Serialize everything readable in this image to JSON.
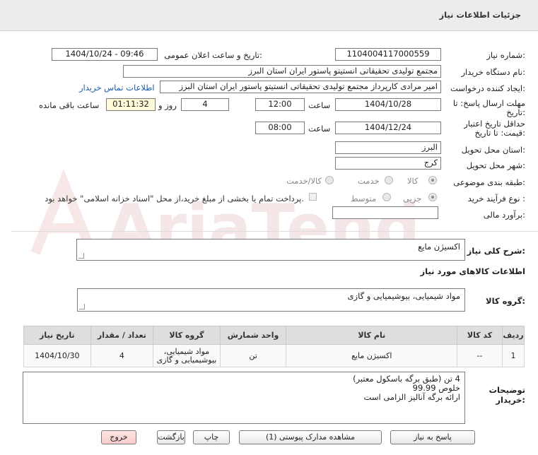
{
  "header": {
    "title": "جزئیات اطلاعات نیاز"
  },
  "fields": {
    "need_number_label": "شماره نیاز:",
    "need_number": "1104004117000559",
    "announce_label": "تاریخ و ساعت اعلان عمومی:",
    "announce_value": "1404/10/24 - 09:46",
    "buyer_org_label": "نام دستگاه خریدار:",
    "buyer_org": "مجتمع تولیدی تحقیقاتی انستیتو پاستور ایران استان البرز",
    "creator_label": "ایجاد کننده درخواست:",
    "creator": "امیر مرادی کارپرداز مجتمع تولیدی تحقیقاتی انستیتو پاستور ایران استان البرز",
    "contact_link": "اطلاعات تماس خریدار",
    "deadline_label_1": "مهلت ارسال پاسخ: تا",
    "deadline_label_2": "تاریخ:",
    "deadline_date": "1404/10/28",
    "time_label": "ساعت",
    "deadline_time": "12:00",
    "days_value": "4",
    "days_and_label": "روز و",
    "remaining_time": "01:11:32",
    "remaining_label": "ساعت باقی مانده",
    "validity_label_1": "حداقل تاریخ اعتبار",
    "validity_label_2": "قیمت: تا تاریخ:",
    "validity_date": "1404/12/24",
    "validity_time": "08:00",
    "province_label": "استان محل تحویل:",
    "province": "البرز",
    "city_label": "شهر محل تحویل:",
    "city": "کرج",
    "category_label": "طبقه بندی موضوعی:",
    "category_options": [
      "کالا",
      "خدمت",
      "کالا/خدمت"
    ],
    "category_selected": "کالا",
    "process_label": "نوع فرآیند خرید :",
    "process_options": [
      "جزیی",
      "متوسط"
    ],
    "process_selected": "جزیی",
    "payment_note": "پرداخت تمام یا بخشی از مبلغ خرید،از محل \"اسناد خزانه اسلامی\" خواهد بود.",
    "estimate_label": "برآورد مالی:",
    "estimate_value": ""
  },
  "summary": {
    "label": "شرح کلی نیاز:",
    "value": "اکسیژن مایع"
  },
  "items_section": {
    "title": "اطلاعات کالاهای مورد نیاز",
    "group_label": "گروه کالا:",
    "group_value": "مواد شیمیایی، بیوشیمیایی و گازی"
  },
  "table": {
    "headers": [
      "ردیف",
      "کد کالا",
      "نام کالا",
      "واحد شمارش",
      "گروه کالا",
      "تعداد / مقدار",
      "تاریخ نیاز"
    ],
    "rows": [
      [
        "1",
        "--",
        "اکسیژن مایع",
        "تن",
        "مواد شیمیایی، بیوشیمیایی و گازی",
        "4",
        "1404/10/30"
      ]
    ]
  },
  "buyer_notes": {
    "label_1": "توضیحات",
    "label_2": "خریدار:",
    "lines": [
      "4 تن (طبق برگه باسکول معتبر)",
      "خلوص 99.99",
      "ارائه برگه آنالیز الزامی است"
    ]
  },
  "buttons": {
    "reply": "پاسخ به نیاز",
    "attachments": "مشاهده مدارک پیوستی (1)",
    "print": "چاپ",
    "back": "بازگشت",
    "exit": "خروج"
  },
  "watermark": {
    "text": "AriaTender.neT"
  },
  "colors": {
    "link": "#1a5bb5",
    "header_bg": "#ececec",
    "remaining_bg": "#fffbd8",
    "exit_bg": "#f8cccc"
  }
}
